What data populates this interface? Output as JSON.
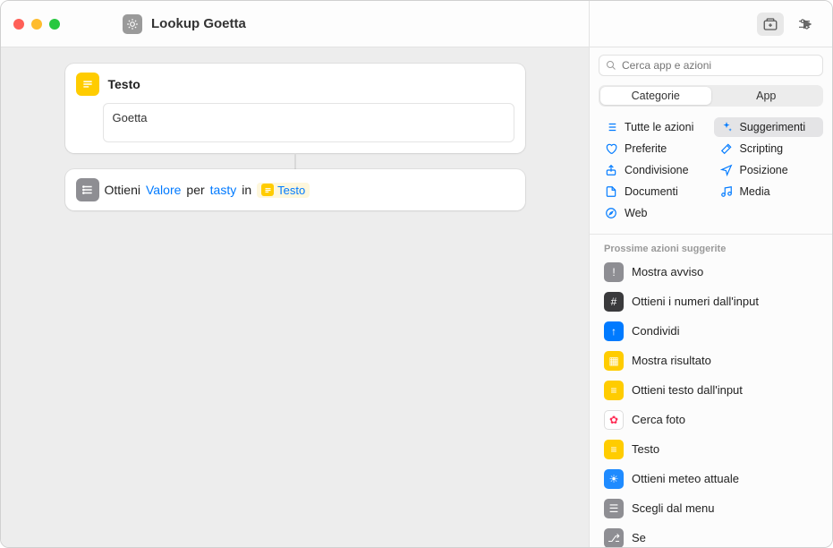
{
  "window": {
    "title": "Lookup Goetta"
  },
  "toolbar": {
    "share_icon": "share-icon",
    "run_icon": "play-icon",
    "library_icon": "library-icon",
    "settings_icon": "sliders-icon"
  },
  "actions": [
    {
      "type": "text",
      "title": "Testo",
      "value": "Goetta"
    },
    {
      "type": "dictionary",
      "prefix": "Ottieni",
      "param1": "Valore",
      "mid1": "per",
      "param2": "tasty",
      "mid2": "in",
      "var_label": "Testo"
    }
  ],
  "sidebar": {
    "search_placeholder": "Cerca app e azioni",
    "segments": [
      "Categorie",
      "App"
    ],
    "active_segment": 0,
    "categories_left": [
      {
        "label": "Tutte le azioni",
        "icon": "list"
      },
      {
        "label": "Preferite",
        "icon": "heart"
      },
      {
        "label": "Condivisione",
        "icon": "share"
      },
      {
        "label": "Documenti",
        "icon": "doc"
      },
      {
        "label": "Web",
        "icon": "safari"
      }
    ],
    "categories_right": [
      {
        "label": "Suggerimenti",
        "icon": "sparkle",
        "selected": true
      },
      {
        "label": "Scripting",
        "icon": "wand"
      },
      {
        "label": "Posizione",
        "icon": "location"
      },
      {
        "label": "Media",
        "icon": "music"
      }
    ],
    "section_title": "Prossime azioni suggerite",
    "suggestions": [
      {
        "label": "Mostra avviso",
        "bg": "#8e8e93",
        "glyph": "!"
      },
      {
        "label": "Ottieni i numeri dall'input",
        "bg": "#3a3a3c",
        "glyph": "#"
      },
      {
        "label": "Condividi",
        "bg": "#007aff",
        "glyph": "↑"
      },
      {
        "label": "Mostra risultato",
        "bg": "#ffcc00",
        "glyph": "▦"
      },
      {
        "label": "Ottieni testo dall'input",
        "bg": "#ffcc00",
        "glyph": "≡"
      },
      {
        "label": "Cerca foto",
        "bg": "#ffffff",
        "glyph": "✿",
        "fg": "#ff2d55",
        "border": true
      },
      {
        "label": "Testo",
        "bg": "#ffcc00",
        "glyph": "≡"
      },
      {
        "label": "Ottieni meteo attuale",
        "bg": "#1f8bff",
        "glyph": "☀"
      },
      {
        "label": "Scegli dal menu",
        "bg": "#8e8e93",
        "glyph": "☰"
      },
      {
        "label": "Se",
        "bg": "#8e8e93",
        "glyph": "⎇"
      }
    ]
  }
}
